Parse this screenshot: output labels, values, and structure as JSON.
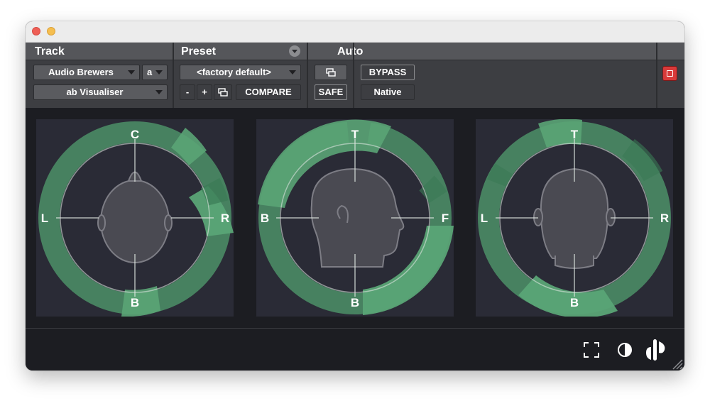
{
  "window": {
    "close_color": "#ee5f56",
    "minimize_color": "#f5be4f"
  },
  "header": {
    "track": {
      "title": "Track",
      "name": "Audio Brewers",
      "channel": "a",
      "plugin": "ab Visualiser"
    },
    "preset": {
      "title": "Preset",
      "name": "<factory default>",
      "minus": "-",
      "plus": "+",
      "compare": "COMPARE"
    },
    "auto": {
      "title": "Auto",
      "safe": "SAFE"
    },
    "bypass": "BYPASS",
    "native": "Native",
    "icons": {
      "preset_menu": "chevron-down-icon",
      "copy": "copy-settings-icon",
      "power": "plugin-power-icon"
    }
  },
  "views": [
    {
      "name": "top",
      "labels": {
        "top": "C",
        "left": "L",
        "right": "R",
        "bottom": "B"
      },
      "head": "head-top-icon"
    },
    {
      "name": "side",
      "labels": {
        "top": "T",
        "left": "B",
        "right": "F",
        "bottom": "B"
      },
      "head": "head-side-icon"
    },
    {
      "name": "front",
      "labels": {
        "top": "T",
        "left": "L",
        "right": "R",
        "bottom": "B"
      },
      "head": "head-front-icon"
    }
  ],
  "colors": {
    "accent": "#4f9a6c",
    "panel": "#2a2b36",
    "background": "#1c1d22"
  },
  "footer": {
    "icons": [
      "fullscreen-icon",
      "contrast-icon",
      "audio-brewers-logo-icon"
    ]
  }
}
